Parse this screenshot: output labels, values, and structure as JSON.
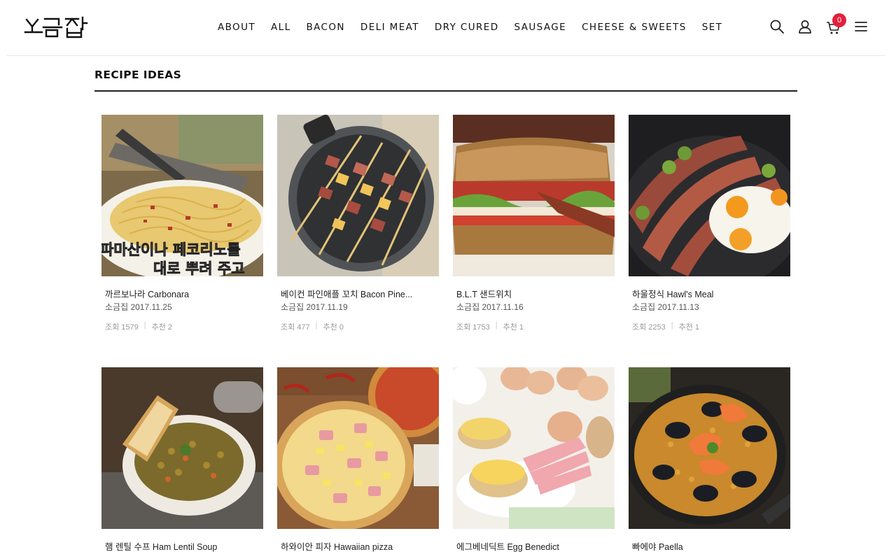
{
  "brand": {
    "logo_text": "소금집"
  },
  "nav": {
    "items": [
      "ABOUT",
      "ALL",
      "BACON",
      "DELI MEAT",
      "DRY CURED",
      "SAUSAGE",
      "CHEESE & SWEETS",
      "SET"
    ]
  },
  "header_icons": {
    "search": "search-icon",
    "account": "user-icon",
    "cart": "cart-icon",
    "menu": "hamburger-icon",
    "cart_count": "0",
    "badge_color": "#e2203d"
  },
  "section": {
    "title": "RECIPE IDEAS"
  },
  "posts": [
    {
      "title": "까르보나라 Carbonara",
      "author_date": "소금집 2017.11.25",
      "views": "조회 1579",
      "likes": "추천 2",
      "overlay_line1": "파마산이나 페코리노를",
      "overlay_line2": "대로 뿌려 주고"
    },
    {
      "title": "베이컨 파인애플 꼬치 Bacon Pine...",
      "author_date": "소금집 2017.11.19",
      "views": "조회 477",
      "likes": "추천 0"
    },
    {
      "title": "B.L.T 샌드위치",
      "author_date": "소금집 2017.11.16",
      "views": "조회 1753",
      "likes": "추천 1"
    },
    {
      "title": "하울정식 Hawl's Meal",
      "author_date": "소금집 2017.11.13",
      "views": "조회 2253",
      "likes": "추천 1"
    },
    {
      "title": "햄 렌틸 수프 Ham Lentil Soup"
    },
    {
      "title": "하와이안 피자 Hawaiian pizza"
    },
    {
      "title": "에그베네딕트 Egg Benedict"
    },
    {
      "title": "빠에야 Paella"
    }
  ],
  "stats_separator": "|"
}
